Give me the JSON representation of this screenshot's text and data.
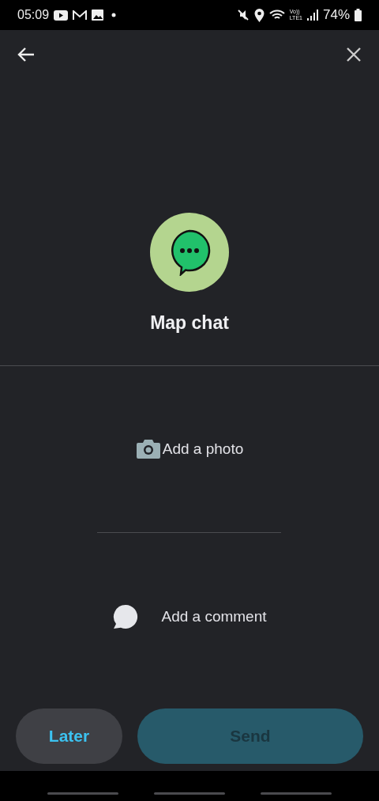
{
  "status_bar": {
    "time": "05:09",
    "network_top": "Vo))",
    "network_bottom": "LTE1",
    "battery": "74%"
  },
  "hero": {
    "title": "Map chat"
  },
  "actions": [
    {
      "kind": "photo",
      "label": "Add a photo"
    },
    {
      "kind": "comment",
      "label": "Add a comment"
    }
  ],
  "buttons": [
    {
      "kind": "secondary",
      "label": "Later",
      "disabled": false
    },
    {
      "kind": "primary",
      "label": "Send",
      "disabled": true
    }
  ]
}
